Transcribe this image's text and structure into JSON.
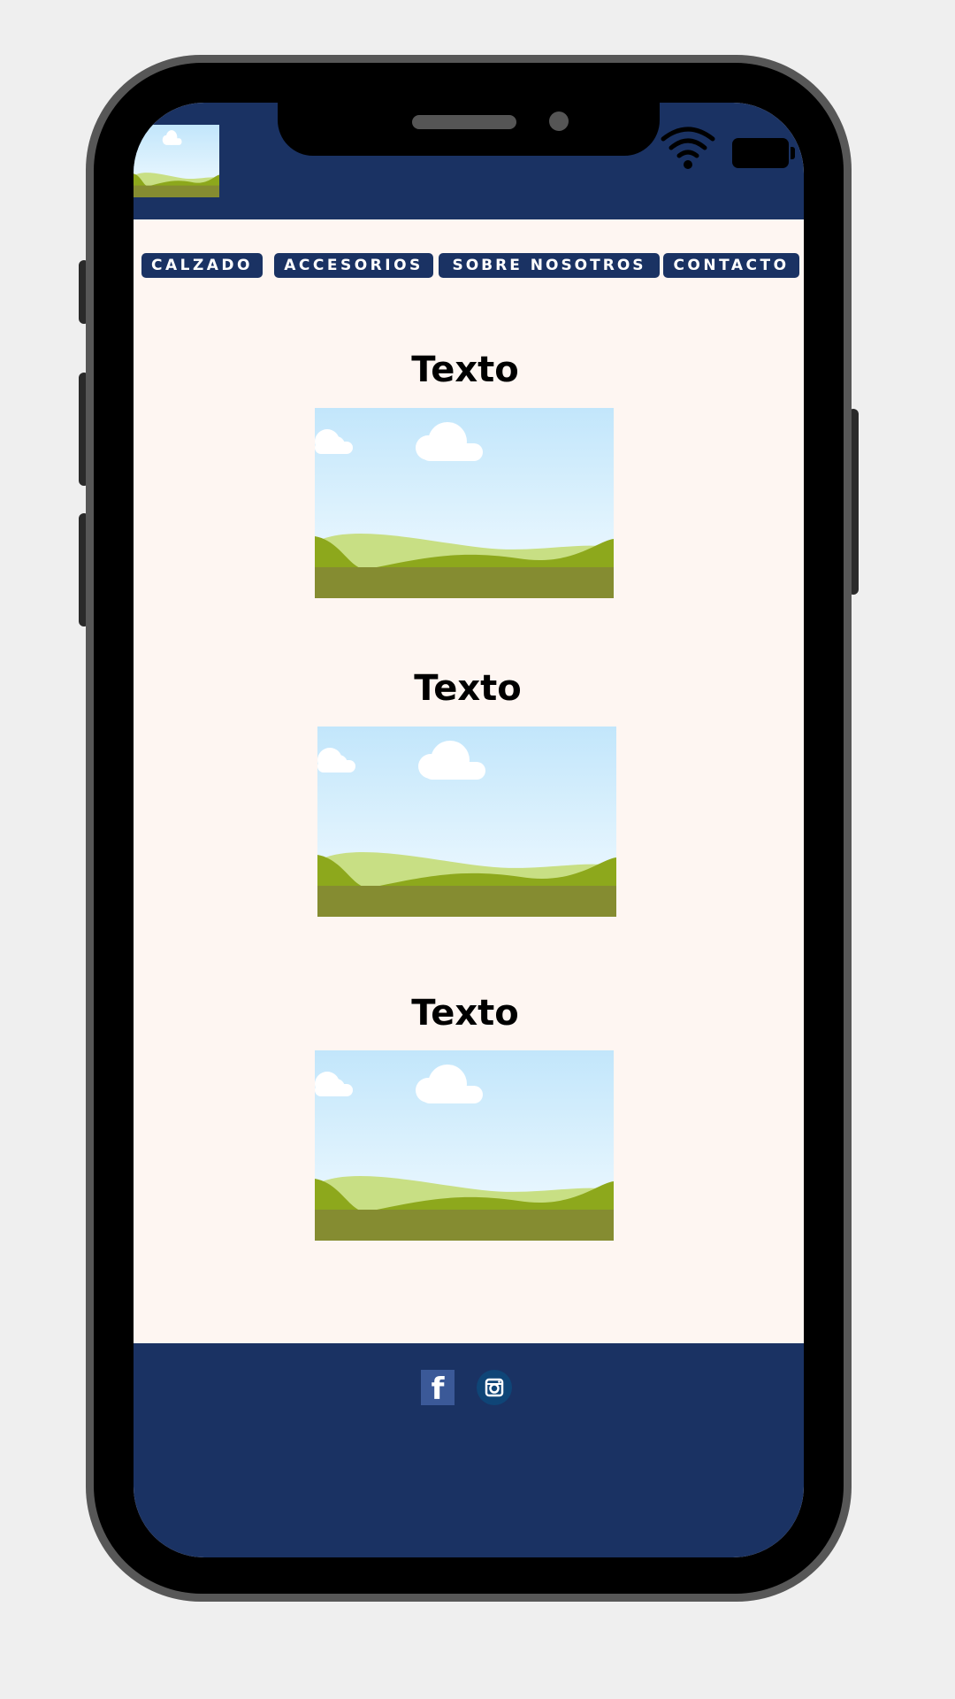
{
  "header": {
    "logo_icon": "landscape-image-placeholder-icon",
    "status_icons": [
      "wifi-icon",
      "battery-icon"
    ]
  },
  "nav": {
    "items": [
      {
        "label": "CALZADO"
      },
      {
        "label": "ACCESORIOS"
      },
      {
        "label": "SOBRE NOSOTROS"
      },
      {
        "label": "CONTACTO"
      }
    ]
  },
  "main": {
    "sections": [
      {
        "title": "Texto",
        "image_icon": "landscape-image-placeholder-icon"
      },
      {
        "title": "Texto",
        "image_icon": "landscape-image-placeholder-icon"
      },
      {
        "title": "Texto",
        "image_icon": "landscape-image-placeholder-icon"
      }
    ]
  },
  "footer": {
    "facebook_glyph": "f",
    "social_icons": [
      "facebook-icon",
      "instagram-icon"
    ]
  },
  "colors": {
    "brand_navy": "#1a3263",
    "page_background": "#fef6f2",
    "facebook_blue": "#3b5998",
    "instagram_blue": "#0f4577"
  }
}
